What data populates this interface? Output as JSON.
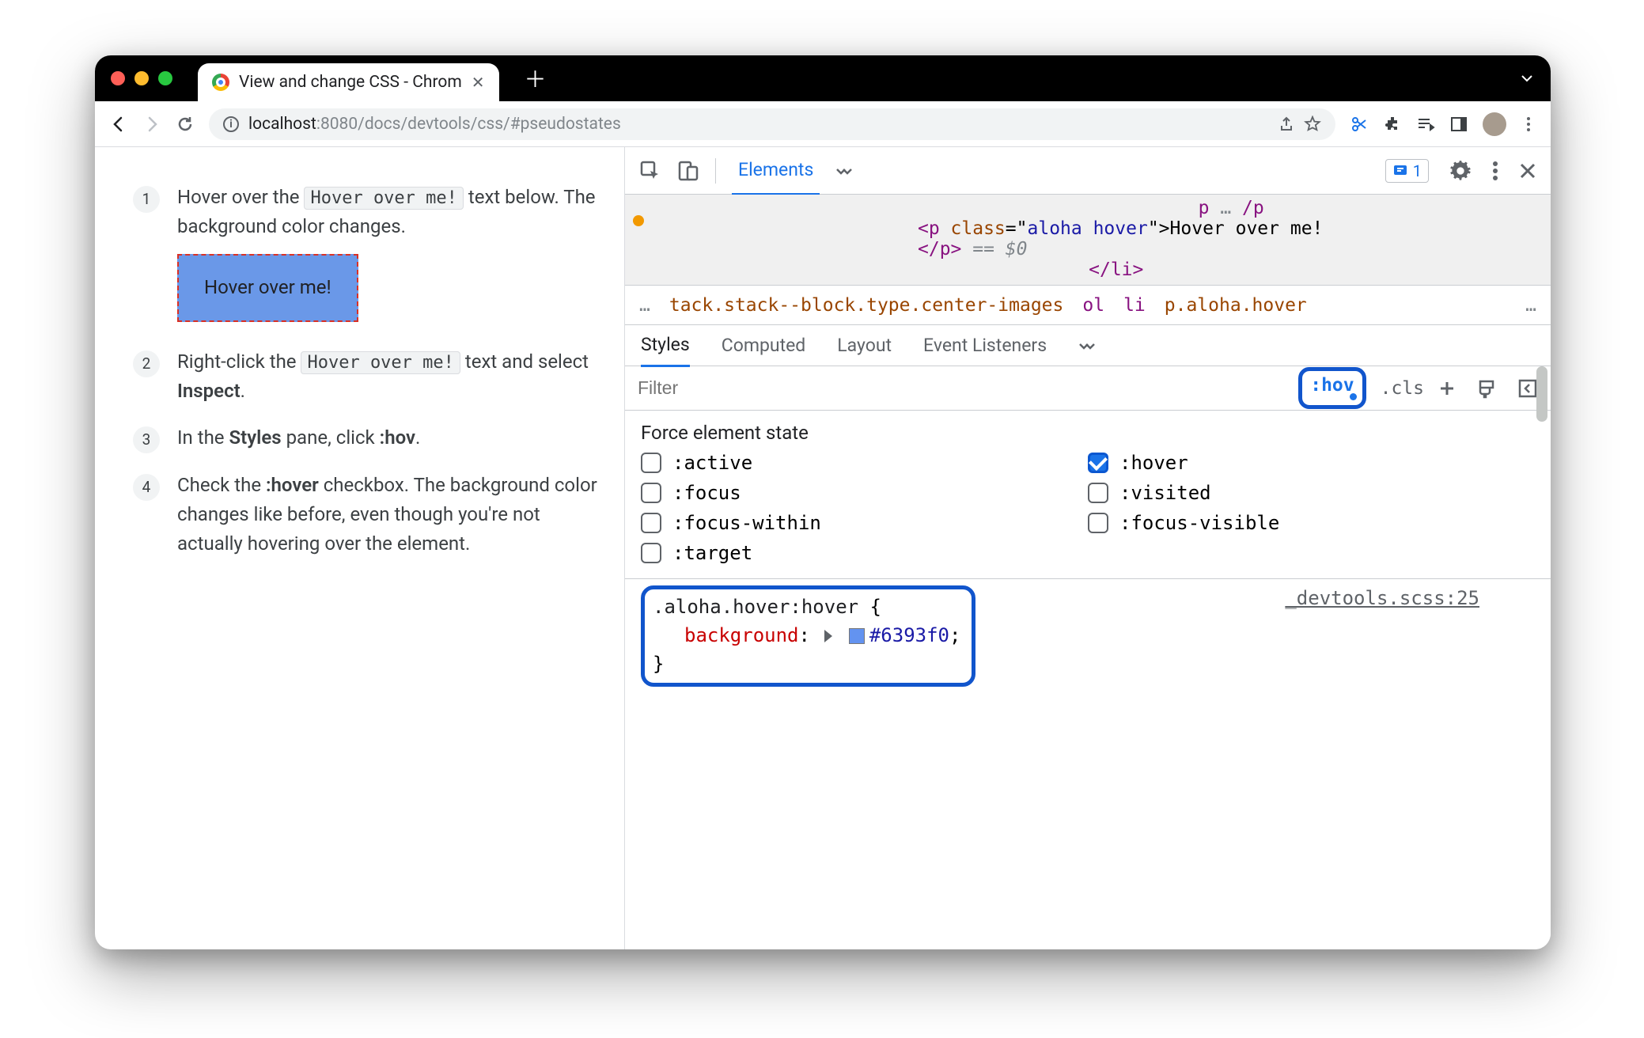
{
  "window": {
    "tab_title": "View and change CSS - Chrom",
    "url_host": "localhost",
    "url_port": ":8080",
    "url_path": "/docs/devtools/css/#pseudostates"
  },
  "doc": {
    "step1": {
      "pre": "Hover over the ",
      "code": "Hover over me!",
      "post": " text below. The background color changes."
    },
    "hover_demo": "Hover over me!",
    "step2": {
      "pre": "Right-click the ",
      "code": "Hover over me!",
      "mid": " text and select ",
      "bold": "Inspect",
      "post": "."
    },
    "step3": {
      "pre": "In the ",
      "bold1": "Styles",
      "mid": " pane, click ",
      "bold2": ":hov",
      "post": "."
    },
    "step4": {
      "pre": "Check the ",
      "bold": ":hover",
      "post": " checkbox. The background color changes like before, even though you're not actually hovering over the element."
    }
  },
  "devtools": {
    "tab_elements": "Elements",
    "issues_count": "1",
    "dom_line_top": "p … /p",
    "dom_p_open": "<p ",
    "dom_class_attr": "class",
    "dom_class_eq": "=\"",
    "dom_class_val": "aloha hover",
    "dom_class_close": "\">",
    "dom_text": "Hover over me!",
    "dom_p_close": "</p>",
    "dom_eq0": " == $0",
    "crumbs": {
      "dots": "…",
      "long": "tack.stack--block.type.center-images",
      "ol": "ol",
      "li": "li",
      "sel": "p.aloha.hover",
      "tail": "…"
    },
    "subtabs": {
      "styles": "Styles",
      "computed": "Computed",
      "layout": "Layout",
      "listeners": "Event Listeners"
    },
    "filter_placeholder": "Filter",
    "hov_label": ":hov",
    "cls_label": ".cls",
    "force_title": "Force element state",
    "states": {
      "active": ":active",
      "hover": ":hover",
      "focus": ":focus",
      "visited": ":visited",
      "focus_within": ":focus-within",
      "focus_visible": ":focus-visible",
      "target": ":target"
    },
    "rule": {
      "selector": ".aloha.hover:hover",
      "open": " {",
      "prop": "background",
      "colon": ":",
      "value": "#6393f0",
      "semi": ";",
      "close": "}",
      "source": "_devtools.scss:25"
    }
  }
}
